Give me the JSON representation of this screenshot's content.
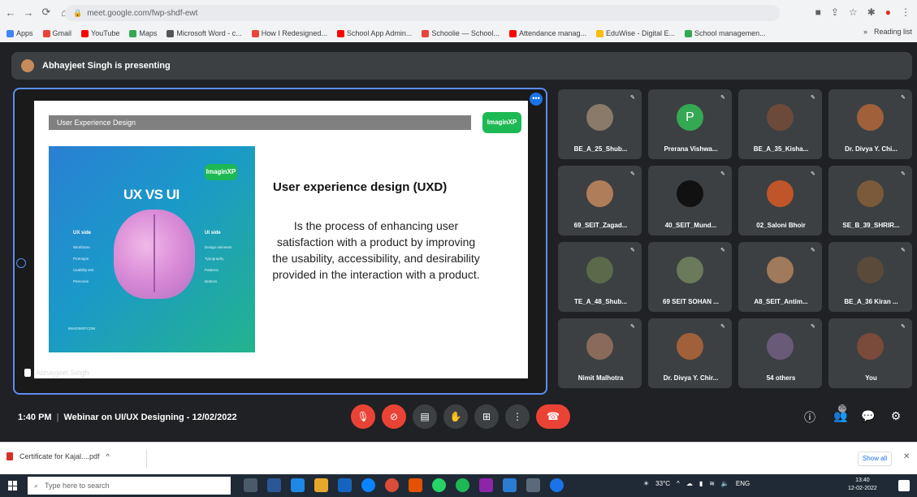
{
  "browser": {
    "url": "meet.google.com/fwp-shdf-ewt",
    "bookmarks": [
      {
        "label": "Apps",
        "color": "#4285f4"
      },
      {
        "label": "Gmail",
        "color": "#ea4335"
      },
      {
        "label": "YouTube",
        "color": "#ff0000"
      },
      {
        "label": "Maps",
        "color": "#34a853"
      },
      {
        "label": "Microsoft Word - c...",
        "color": "#555555"
      },
      {
        "label": "How I Redesigned...",
        "color": "#e8453c"
      },
      {
        "label": "School App Admin...",
        "color": "#ff0000"
      },
      {
        "label": "Schoolie — School...",
        "color": "#e8453c"
      },
      {
        "label": "Attendance manag...",
        "color": "#ff0000"
      },
      {
        "label": "EduWise - Digital E...",
        "color": "#fbbc04"
      },
      {
        "label": "School managemen...",
        "color": "#34a853"
      }
    ],
    "reading_list": "Reading list"
  },
  "meet": {
    "presenting_text": "Abhayjeet Singh is presenting",
    "presenter_name": "Abhayjeet Singh",
    "slide": {
      "top_bar": "User Experience Design",
      "logo": "ImaginXP",
      "panel_title": "UX VS UI",
      "ux_side_label": "UX side",
      "ui_side_label": "UI side",
      "ux_items": [
        "Wireframe",
        "Prototype",
        "Usability test",
        "Personas"
      ],
      "ui_items": [
        "Design elements",
        "Typography",
        "Patterns",
        "Buttons"
      ],
      "panel_footer": "IMAGINXP.COM",
      "heading": "User experience design (UXD)",
      "description": "Is the process of enhancing user satisfaction with a product by improving the usability, accessibility, and desirability provided in the interaction with a product."
    },
    "participants": [
      {
        "name": "BE_A_25_Shub...",
        "avatar": "#8a7a6a"
      },
      {
        "name": "Prerana Vishwa...",
        "avatar": "#34a853",
        "letter": "P"
      },
      {
        "name": "BE_A_35_Kisha...",
        "avatar": "#6b4a3a"
      },
      {
        "name": "Dr. Divya Y. Chi...",
        "avatar": "#a0603a"
      },
      {
        "name": "69_SEIT_Zagad...",
        "avatar": "#b07d5a"
      },
      {
        "name": "40_SEIT_Mund...",
        "avatar": "#111111"
      },
      {
        "name": "02_Saloni Bhoir",
        "avatar": "#c0552a"
      },
      {
        "name": "SE_B_39_SHRIR...",
        "avatar": "#7a5a3a"
      },
      {
        "name": "TE_A_48_Shub...",
        "avatar": "#5a6a4a"
      },
      {
        "name": "69 SEIT SOHAN ...",
        "avatar": "#6a7a5a"
      },
      {
        "name": "A8_SEIT_Antim...",
        "avatar": "#a07a5a"
      },
      {
        "name": "BE_A_36 Kiran ...",
        "avatar": "#5a4a3a"
      },
      {
        "name": "Nimit Malhotra",
        "avatar": "#8a6a5a"
      },
      {
        "name": "Dr. Divya Y. Chir...",
        "avatar": "#a0603a"
      },
      {
        "name": "54 others",
        "avatar": "#6a5a7a"
      },
      {
        "name": "You",
        "avatar": "#7a4a3a"
      }
    ],
    "time": "1:40 PM",
    "meeting_title": "Webinar on UI/UX Designing - 12/02/2022",
    "controls": {
      "mic": "mic-off",
      "camera": "camera-off",
      "captions": "CC",
      "hand": "raise-hand",
      "present": "present",
      "more": "more",
      "hangup": "end-call"
    },
    "people_count": "70"
  },
  "download": {
    "file": "Certificate for Kajal....pdf",
    "show_all": "Show all"
  },
  "taskbar": {
    "search_placeholder": "Type here to search",
    "weather": "33°C",
    "language": "ENG",
    "time": "13:40",
    "date": "12-02-2022"
  }
}
